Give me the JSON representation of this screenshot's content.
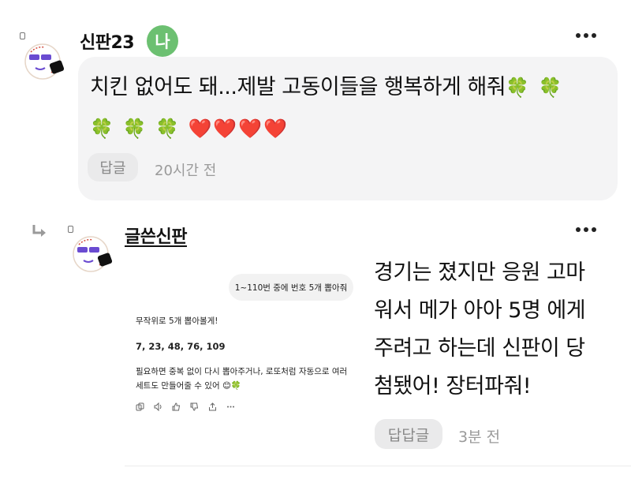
{
  "comment": {
    "username": "신판23",
    "me_badge": "나",
    "text_line1": "치킨 없어도 돼...제발 고동이들을 행복하게 해줘",
    "text_line1_emoji": "🍀 🍀",
    "text_line2_emoji": "🍀 🍀 🍀 ❤️❤️❤️❤️",
    "reply_label": "답글",
    "time": "20시간 전",
    "more_icon": "more-icon"
  },
  "reply": {
    "username": "글쓴신판",
    "text_lines": [
      "경기는 졌지만 응원 고마",
      "워서 메가 아아 5명 에게",
      "주려고 하는데 신판이 당",
      "첨됐어! 장터파줘!"
    ],
    "reply_label": "답답글",
    "time": "3분 전",
    "screenshot": {
      "user_bubble": "1~110번 중에 번호 5개 뽑아줘",
      "line1": "무작위로 5개 뽑아볼게!",
      "numbers": "7, 23, 48, 76, 109",
      "line3a": "필요하면 중복 없이 다시 뽑아주거나, 로또처럼 자동으로 여러",
      "line3b": "세트도 만들어줄 수 있어 😊🍀"
    }
  }
}
